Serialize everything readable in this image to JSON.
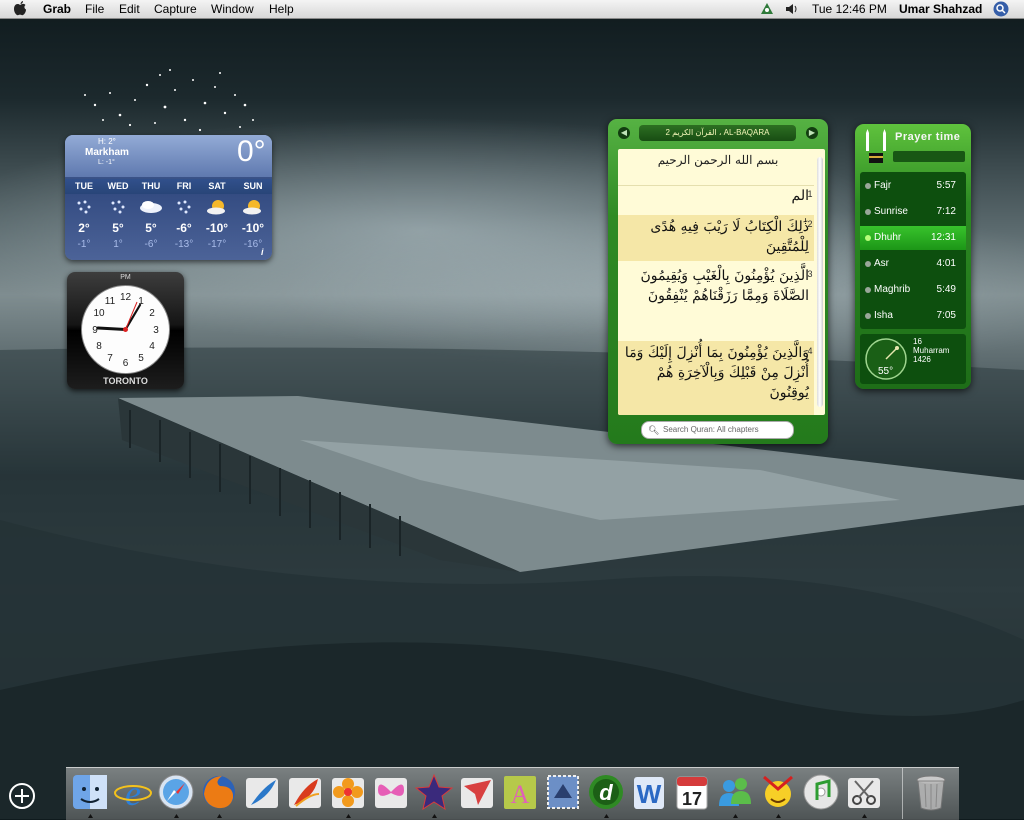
{
  "menubar": {
    "app_name": "Grab",
    "menus": [
      "File",
      "Edit",
      "Capture",
      "Window",
      "Help"
    ],
    "clock": "Tue 12:46 PM",
    "user": "Umar Shahzad"
  },
  "weather": {
    "city": "Markham",
    "high": "H: 2°",
    "low": "L: -1°",
    "current_temp": "0°",
    "info_label": "i",
    "forecast": [
      {
        "day": "TUE",
        "icon": "snow-icon",
        "high": "2°",
        "low": "-1°"
      },
      {
        "day": "WED",
        "icon": "snow-icon",
        "high": "5°",
        "low": "1°"
      },
      {
        "day": "THU",
        "icon": "cloudy-icon",
        "high": "5°",
        "low": "-6°"
      },
      {
        "day": "FRI",
        "icon": "snow-icon",
        "high": "-6°",
        "low": "-13°"
      },
      {
        "day": "SAT",
        "icon": "partly-sunny-icon",
        "high": "-10°",
        "low": "-17°"
      },
      {
        "day": "SUN",
        "icon": "partly-sunny-icon",
        "high": "-10°",
        "low": "-16°"
      }
    ]
  },
  "clock": {
    "period": "PM",
    "city": "TORONTO",
    "numbers": [
      "12",
      "1",
      "2",
      "3",
      "4",
      "5",
      "6",
      "7",
      "8",
      "9",
      "10",
      "11"
    ]
  },
  "quran": {
    "title": "2 القرآن الكريم ، AL-BAQARA",
    "basmala": "بسم الله الرحمن الرحيم",
    "verses": [
      {
        "num": "1",
        "text": "الم"
      },
      {
        "num": "2",
        "text": "ذَٰلِكَ الْكِتَابُ لَا رَيْبَ فِيهِ هُدًى لِلْمُتَّقِينَ"
      },
      {
        "num": "3",
        "text": "الَّذِينَ يُؤْمِنُونَ بِالْغَيْبِ وَيُقِيمُونَ الصَّلَاةَ وَمِمَّا رَزَقْنَاهُمْ يُنْفِقُونَ"
      },
      {
        "num": "4",
        "text": "وَالَّذِينَ يُؤْمِنُونَ بِمَا أُنْزِلَ إِلَيْكَ وَمَا أُنْزِلَ مِنْ قَبْلِكَ وَبِالْآخِرَةِ هُمْ يُوقِنُونَ"
      }
    ],
    "search_placeholder": "Search Quran: All chapters"
  },
  "prayer": {
    "title": "Prayer time",
    "rows": [
      {
        "name": "Fajr",
        "time": "5:57",
        "active": false
      },
      {
        "name": "Sunrise",
        "time": "7:12",
        "active": false
      },
      {
        "name": "Dhuhr",
        "time": "12:31",
        "active": true
      },
      {
        "name": "Asr",
        "time": "4:01",
        "active": false
      },
      {
        "name": "Maghrib",
        "time": "5:49",
        "active": false
      },
      {
        "name": "Isha",
        "time": "7:05",
        "active": false
      }
    ],
    "qibla_degrees": "55°",
    "hijri_day": "16",
    "hijri_month": "Muharram",
    "hijri_year": "1426"
  },
  "dock": {
    "calendar_day": "17",
    "items": [
      "finder-icon",
      "internet-explorer-icon",
      "safari-icon",
      "firefox-icon",
      "feather-icon",
      "feather-red-icon",
      "flower-icon",
      "butterfly-icon",
      "star-icon",
      "paper-plane-icon",
      "font-book-icon",
      "mail-stamp-icon",
      "dreamweaver-icon",
      "word-icon",
      "calendar-icon",
      "messenger-icon",
      "yahoo-messenger-icon",
      "itunes-icon",
      "scissors-icon",
      "trash-icon"
    ]
  },
  "colors": {
    "widget_green": "#2f8a24",
    "active_green": "#38c32c",
    "weather_blue": "#31497f"
  }
}
